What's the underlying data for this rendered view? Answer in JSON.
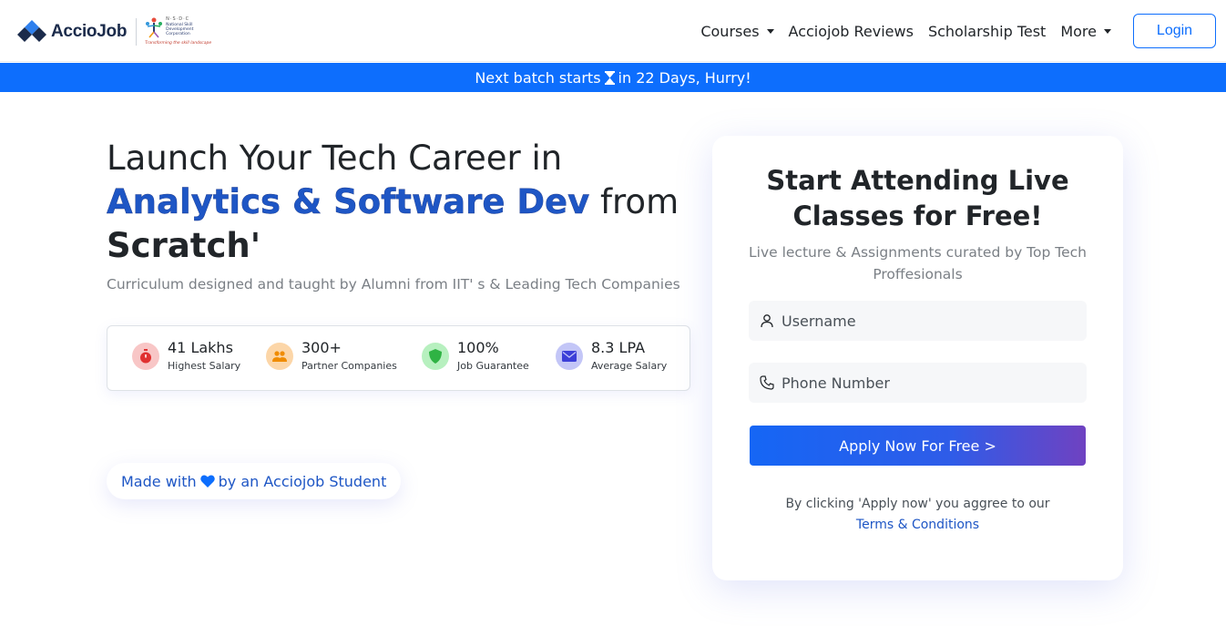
{
  "header": {
    "brand": "AccioJob",
    "partner": {
      "acronym": "N·S·D·C",
      "name": "National Skill Development Corporation",
      "tagline": "Transforming the skill landscape"
    },
    "nav": [
      {
        "label": "Courses",
        "dropdown": true
      },
      {
        "label": "Acciojob Reviews",
        "dropdown": false
      },
      {
        "label": "Scholarship Test",
        "dropdown": false
      },
      {
        "label": "More",
        "dropdown": true
      }
    ],
    "login_label": "Login"
  },
  "banner": {
    "prefix": "Next batch starts",
    "icon": "hourglass-icon",
    "suffix": "in 22 Days, Hurry!"
  },
  "hero": {
    "title_line1": "Launch Your Tech Career in",
    "title_accent": "Analytics & Software Dev",
    "title_from": " from",
    "title_line3": "Scratch'",
    "subtitle": "Curriculum designed and taught by Alumni from IIT' s & Leading Tech Companies",
    "stats": [
      {
        "value": "41 Lakhs",
        "label": "Highest Salary",
        "icon": "stopwatch-icon",
        "bg": "#f8c6c6",
        "fg": "#e03131"
      },
      {
        "value": "300+",
        "label": "Partner Companies",
        "icon": "users-icon",
        "bg": "#fcd6a8",
        "fg": "#f08c00"
      },
      {
        "value": "100%",
        "label": "Job Guarantee",
        "icon": "shield-icon",
        "bg": "#b7f0bf",
        "fg": "#2fb344"
      },
      {
        "value": "8.3 LPA",
        "label": "Average Salary",
        "icon": "envelope-icon",
        "bg": "#c3c6f7",
        "fg": "#3b3fd8"
      }
    ],
    "made_with": {
      "prefix": "Made with",
      "suffix": "by an Acciojob Student"
    }
  },
  "form": {
    "title": "Start Attending Live Classes for Free!",
    "subtitle": "Live lecture & Assignments curated by Top Tech Proffesionals",
    "username_placeholder": "Username",
    "phone_placeholder": "Phone Number",
    "submit_label": "Apply Now For Free >",
    "terms_text": "By clicking 'Apply now' you aggree to our",
    "terms_link": "Terms & Conditions"
  },
  "colors": {
    "primary": "#0d6efd",
    "accent": "#1e56c5",
    "gradient_end": "#6f42c1"
  }
}
